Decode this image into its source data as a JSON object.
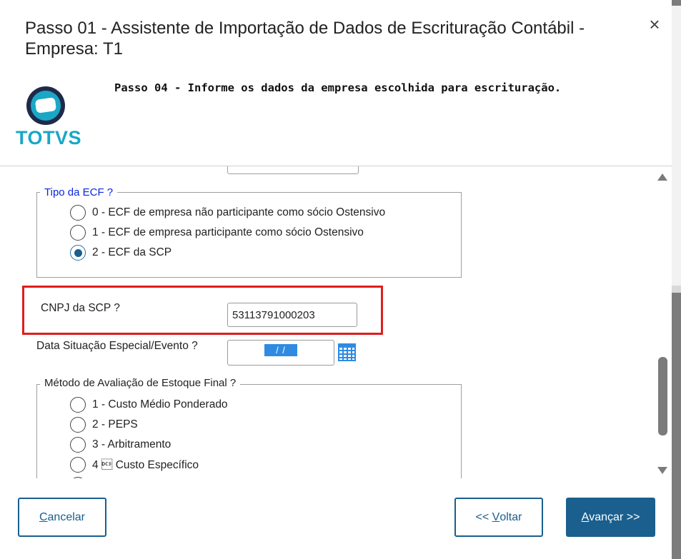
{
  "window": {
    "title": "Passo 01 - Assistente de Importação de Dados de Escrituração Contábil - Empresa: T1",
    "close_label": "×"
  },
  "header": {
    "step_heading": "Passo 04 - Informe os dados da empresa escolhida para escrituração.",
    "logo_text": "TOTVS",
    "colors": {
      "logo_teal": "#1aa7c6",
      "logo_navy": "#1e2a4a"
    }
  },
  "tipo_ecf": {
    "legend": "Tipo da ECF ?",
    "options": [
      {
        "label": "0 - ECF de empresa não participante como sócio Ostensivo",
        "selected": false
      },
      {
        "label": "1 - ECF de empresa participante como sócio Ostensivo",
        "selected": false
      },
      {
        "label": "2 - ECF da SCP",
        "selected": true
      }
    ]
  },
  "cnpj_scp": {
    "label": "CNPJ da SCP ?",
    "value": "53113791000203"
  },
  "data_situacao": {
    "label": "Data Situação Especial/Evento ?",
    "value": " / / "
  },
  "metodo_estoque": {
    "legend": "Método de Avaliação de Estoque Final ?",
    "options": [
      {
        "label": "1 - Custo Médio Ponderado",
        "selected": false
      },
      {
        "label": "2 - PEPS",
        "selected": false
      },
      {
        "label": "3 - Arbitramento",
        "selected": false
      },
      {
        "label": "4 \u0013 Custo Específico",
        "selected": false
      }
    ]
  },
  "footer": {
    "cancel_prefix": "",
    "cancel_mnemonic": "C",
    "cancel_rest": "ancelar",
    "back_prefix": "<< ",
    "back_mnemonic": "V",
    "back_rest": "oltar",
    "next_prefix": "",
    "next_mnemonic": "A",
    "next_rest": "vançar >>"
  },
  "colors": {
    "accent": "#1a5f8e",
    "legend_blue": "#0a26e0",
    "highlight_red": "#e01d1d",
    "date_selection": "#2f8be2"
  }
}
